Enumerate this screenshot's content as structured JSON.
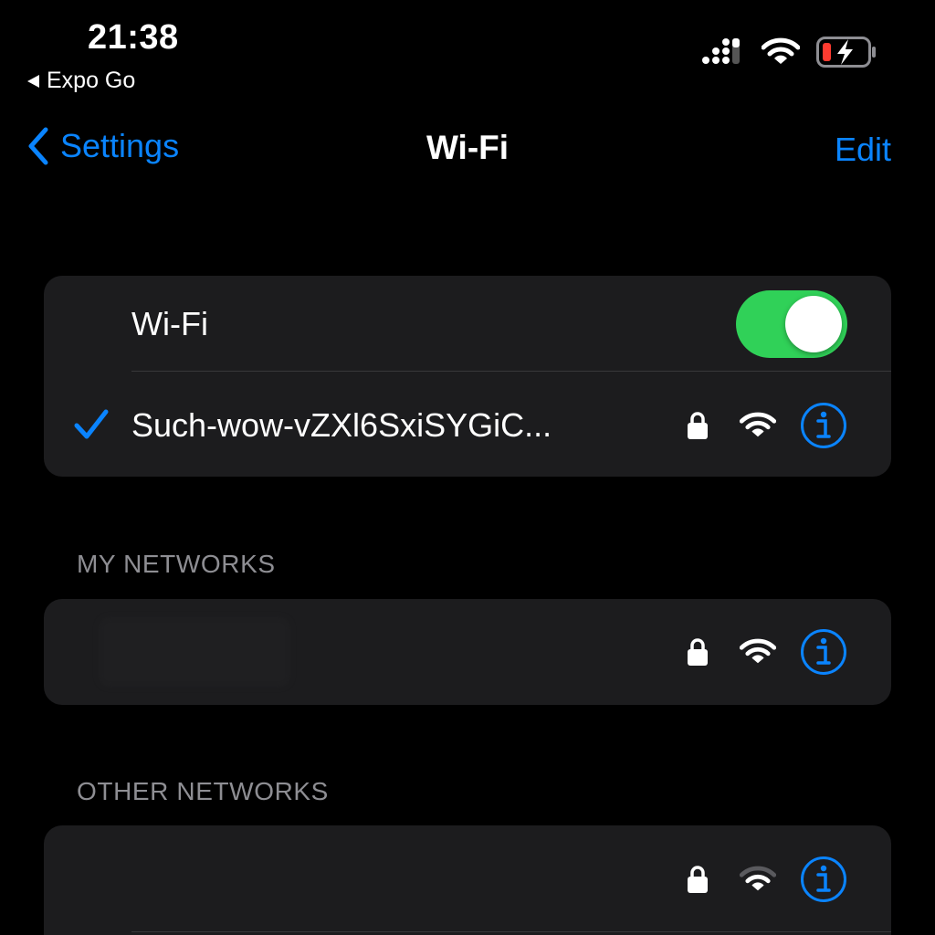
{
  "status_bar": {
    "time": "21:38",
    "back_app": "Expo Go"
  },
  "nav": {
    "back_label": "Settings",
    "title": "Wi-Fi",
    "edit_label": "Edit"
  },
  "wifi_toggle": {
    "label": "Wi-Fi",
    "on": true
  },
  "connected_network": {
    "name": "Such-wow-vZXl6SxiSYGiC..."
  },
  "my_networks": {
    "header": "MY NETWORKS"
  },
  "other_networks": {
    "header": "OTHER NETWORKS"
  },
  "colors": {
    "accent": "#0a84ff",
    "toggle_on": "#30d158",
    "card": "#1c1c1e",
    "background": "#000000",
    "section_header": "#8e8e93",
    "battery_low": "#ff3b30"
  },
  "icons": {
    "back": "chevron-left-icon",
    "check": "checkmark-icon",
    "lock": "lock-icon",
    "wifi": "wifi-icon",
    "info": "info-icon",
    "cellular": "cellular-signal-icon",
    "battery": "battery-charging-icon"
  }
}
